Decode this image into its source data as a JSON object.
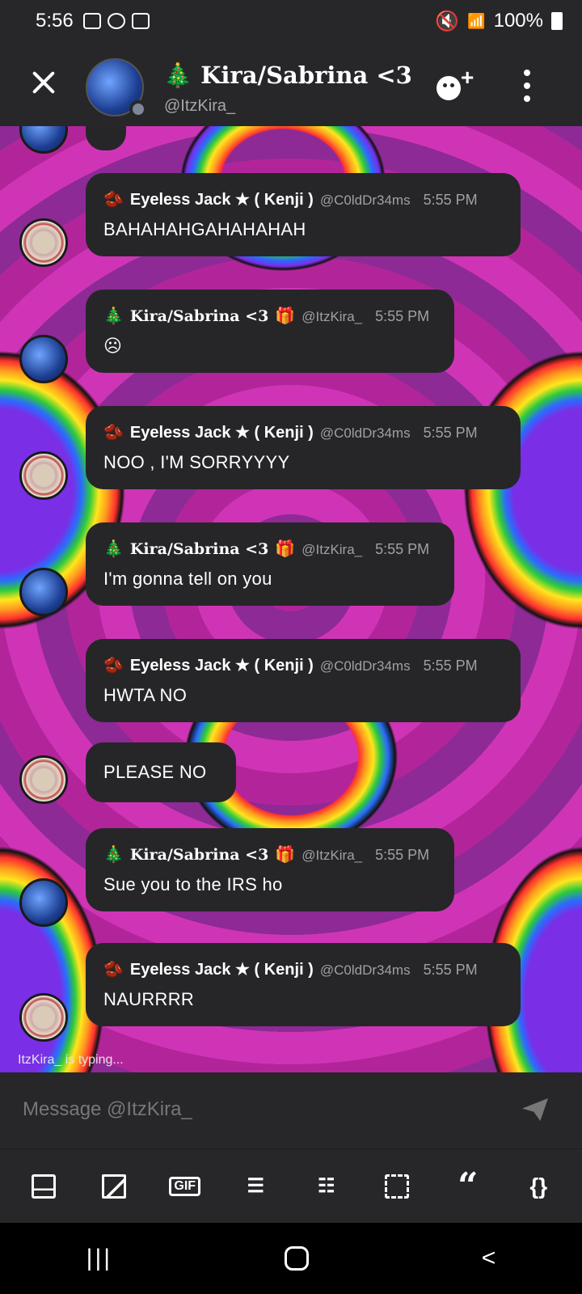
{
  "status_bar": {
    "time": "5:56",
    "battery": "100%"
  },
  "header": {
    "title": "🎄 Kira/Sabrina <3",
    "subtitle": "@ItzKira_"
  },
  "messages": [
    {
      "sender": "jack",
      "emoji": "🫘",
      "name": "Eyeless Jack ★ ( Kenji )",
      "handle": "@C0ldDr34ms",
      "time": "5:55 PM",
      "text": "BAHAHAHGAHAHAHAH"
    },
    {
      "sender": "kira",
      "emoji": "🎄",
      "name": "Kira/Sabrina <3",
      "badge": "🎁",
      "handle": "@ItzKira_",
      "time": "5:55 PM",
      "text": "☹"
    },
    {
      "sender": "jack",
      "emoji": "🫘",
      "name": "Eyeless Jack ★ ( Kenji )",
      "handle": "@C0ldDr34ms",
      "time": "5:55 PM",
      "text": "NOO , I'M SORRYYYY"
    },
    {
      "sender": "kira",
      "emoji": "🎄",
      "name": "Kira/Sabrina <3",
      "badge": "🎁",
      "handle": "@ItzKira_",
      "time": "5:55 PM",
      "text": "I'm gonna tell on you"
    },
    {
      "sender": "jack",
      "emoji": "🫘",
      "name": "Eyeless Jack ★ ( Kenji )",
      "handle": "@C0ldDr34ms",
      "time": "5:55 PM",
      "text": "HWTA NO"
    },
    {
      "sender": "jack",
      "text": "PLEASE NO"
    },
    {
      "sender": "kira",
      "emoji": "🎄",
      "name": "Kira/Sabrina <3",
      "badge": "🎁",
      "handle": "@ItzKira_",
      "time": "5:55 PM",
      "text": "Sue you to the IRS ho"
    },
    {
      "sender": "jack",
      "emoji": "🫘",
      "name": "Eyeless Jack ★ ( Kenji )",
      "handle": "@C0ldDr34ms",
      "time": "5:55 PM",
      "text": "NAURRRR"
    }
  ],
  "typing_indicator": "ItzKira_ is typing...",
  "composer": {
    "placeholder": "Message @ItzKira_"
  },
  "toolbar": {
    "gif_label": "GIF",
    "quote_glyph": "“",
    "code_glyph": "{}",
    "icons": [
      "emoji-keyboard-icon",
      "image-icon",
      "gif-icon",
      "bullet-list-icon",
      "numbered-list-icon",
      "spoiler-icon",
      "quote-icon",
      "code-block-icon"
    ]
  },
  "nav": {
    "recents": "|||",
    "back": "<"
  },
  "colors": {
    "bubble": "#262628",
    "bar": "#27272a",
    "background_magenta": "#b2259a"
  }
}
